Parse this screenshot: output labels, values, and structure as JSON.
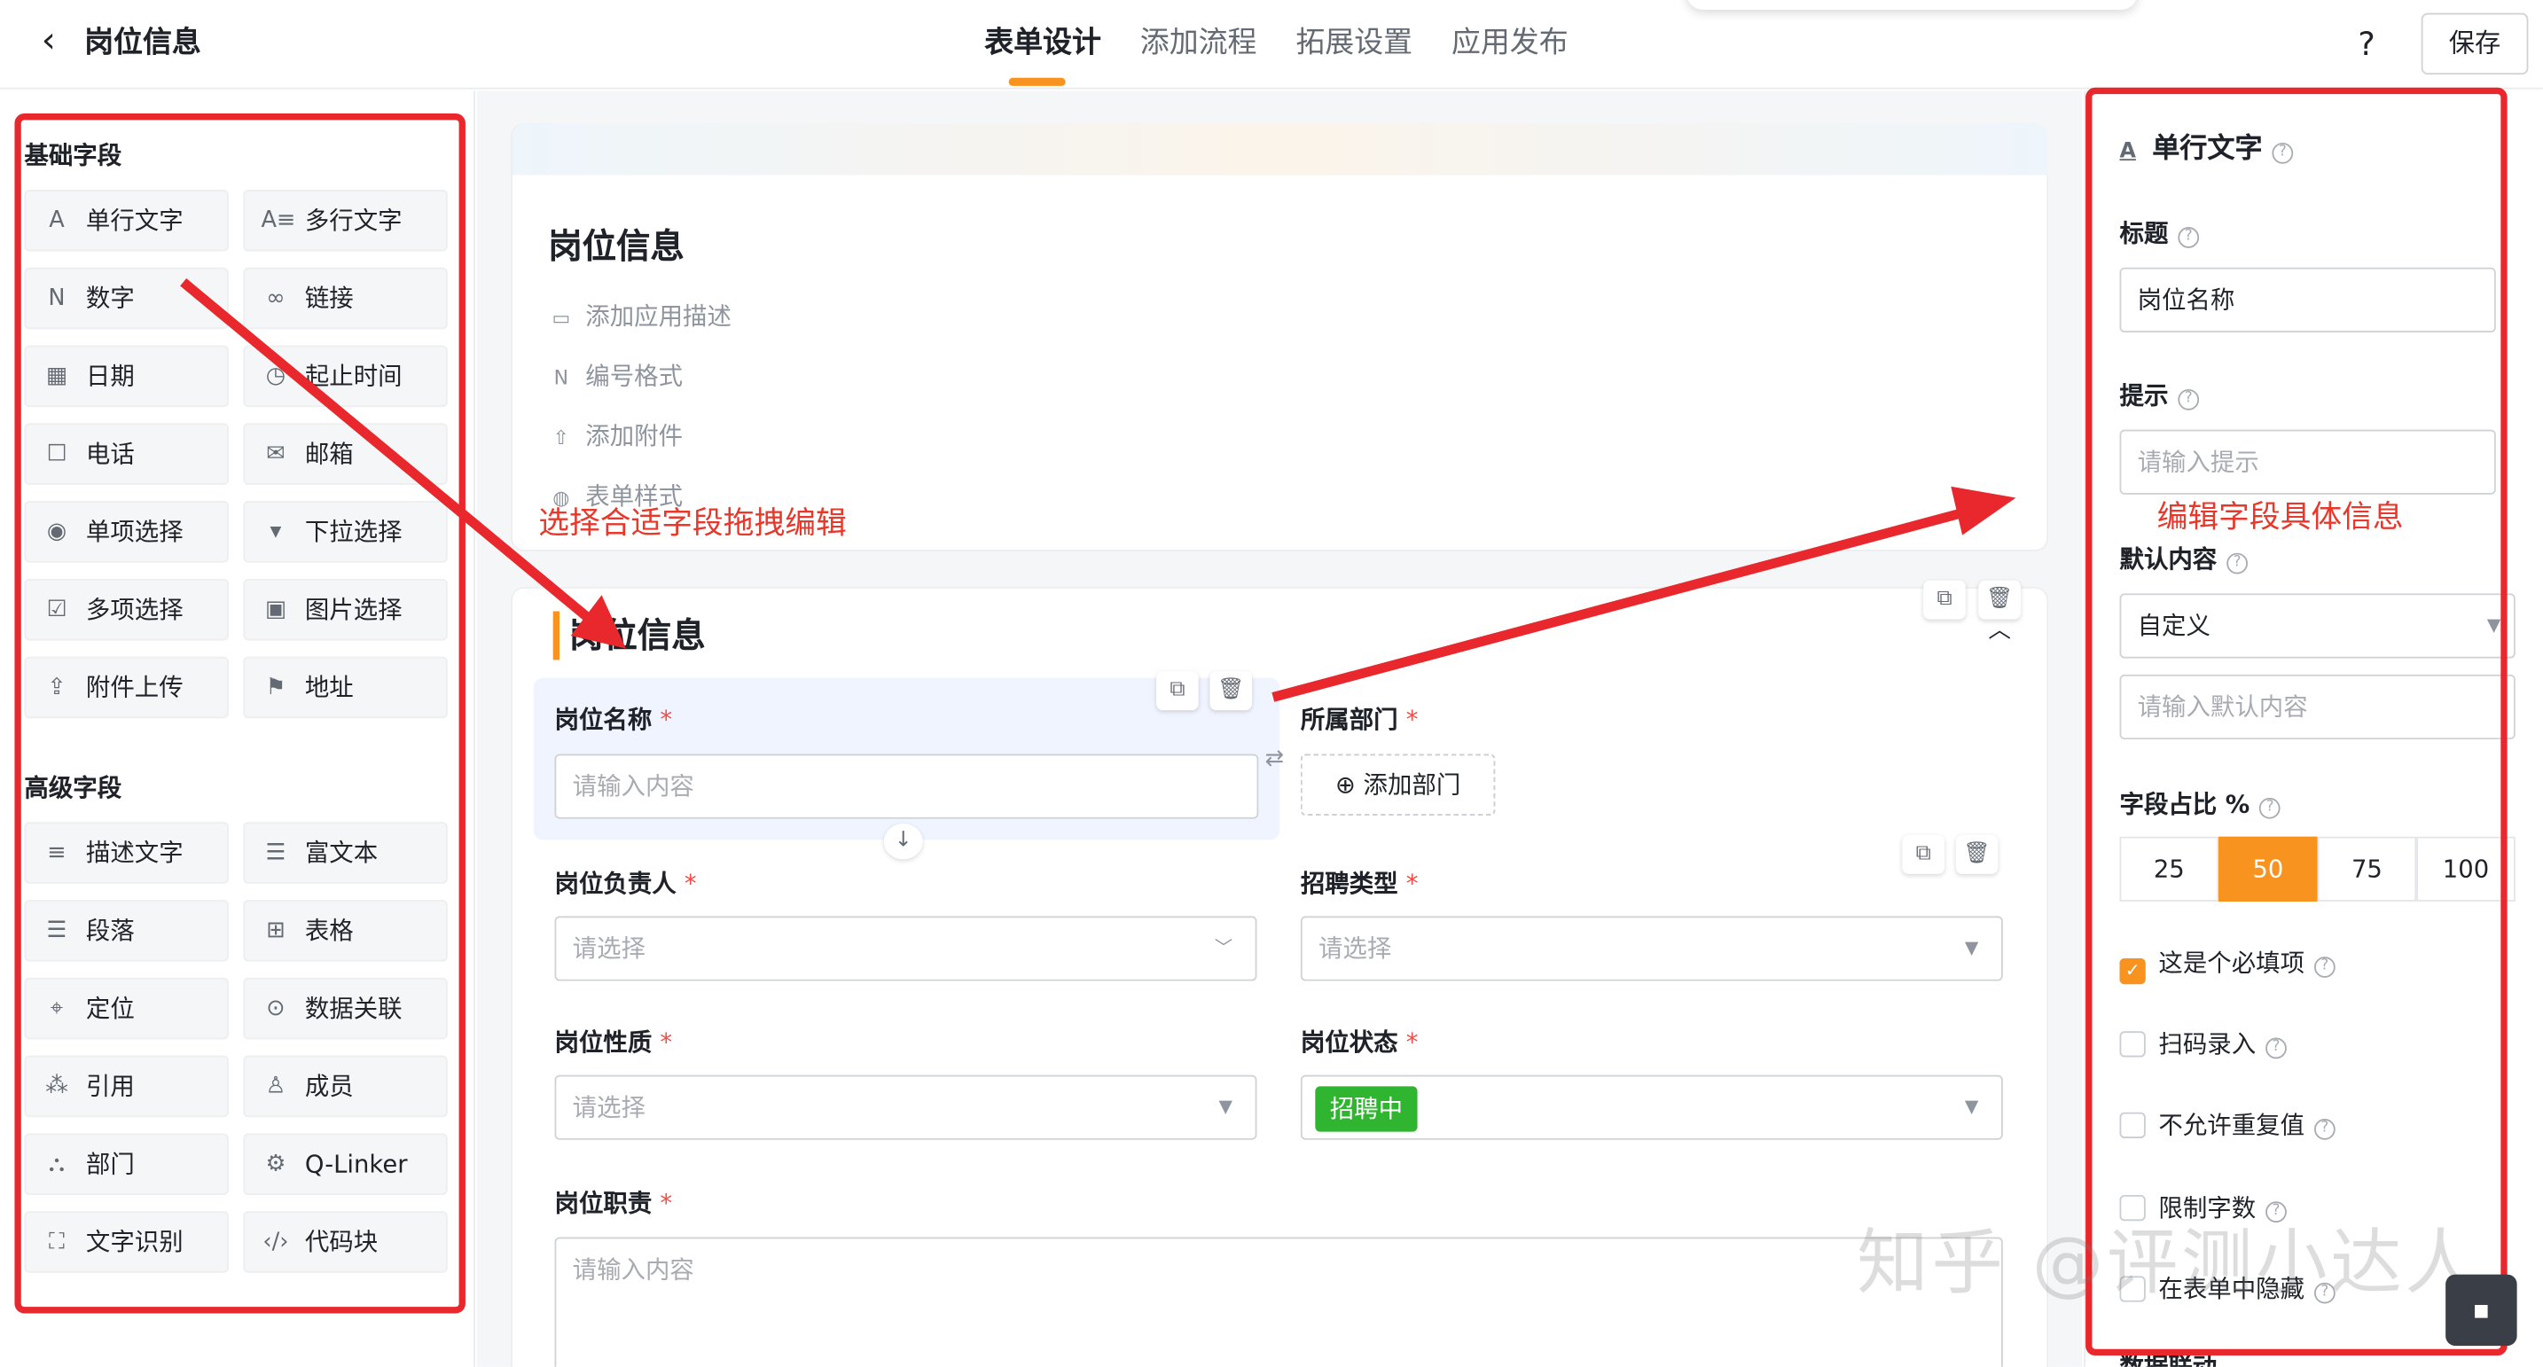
{
  "header": {
    "back_icon": "chevron-left-icon",
    "title": "岗位信息",
    "tabs": [
      "表单设计",
      "添加流程",
      "拓展设置",
      "应用发布"
    ],
    "active_tab": "表单设计",
    "help": "?",
    "save_label": "保存"
  },
  "left_panel": {
    "basic_title": "基础字段",
    "basic_fields": [
      {
        "label": "单行文字",
        "icon": "text-icon",
        "glyph": "A"
      },
      {
        "label": "多行文字",
        "icon": "multiline-text-icon",
        "glyph": "A≡"
      },
      {
        "label": "数字",
        "icon": "number-icon",
        "glyph": "N"
      },
      {
        "label": "链接",
        "icon": "link-icon",
        "glyph": "∞"
      },
      {
        "label": "日期",
        "icon": "calendar-icon",
        "glyph": "▦"
      },
      {
        "label": "起止时间",
        "icon": "date-range-icon",
        "glyph": "◷"
      },
      {
        "label": "电话",
        "icon": "phone-icon",
        "glyph": "☐"
      },
      {
        "label": "邮箱",
        "icon": "mail-icon",
        "glyph": "✉"
      },
      {
        "label": "单项选择",
        "icon": "radio-icon",
        "glyph": "◉"
      },
      {
        "label": "下拉选择",
        "icon": "dropdown-icon",
        "glyph": "▾"
      },
      {
        "label": "多项选择",
        "icon": "checkbox-icon",
        "glyph": "☑"
      },
      {
        "label": "图片选择",
        "icon": "image-icon",
        "glyph": "▣"
      },
      {
        "label": "附件上传",
        "icon": "upload-icon",
        "glyph": "⇪"
      },
      {
        "label": "地址",
        "icon": "address-icon",
        "glyph": "⚑"
      }
    ],
    "advanced_title": "高级字段",
    "advanced_fields": [
      {
        "label": "描述文字",
        "icon": "description-icon",
        "glyph": "≡"
      },
      {
        "label": "富文本",
        "icon": "rich-text-icon",
        "glyph": "☰"
      },
      {
        "label": "段落",
        "icon": "paragraph-icon",
        "glyph": "☰"
      },
      {
        "label": "表格",
        "icon": "table-icon",
        "glyph": "⊞"
      },
      {
        "label": "定位",
        "icon": "location-icon",
        "glyph": "⌖"
      },
      {
        "label": "数据关联",
        "icon": "data-link-icon",
        "glyph": "⊙"
      },
      {
        "label": "引用",
        "icon": "reference-icon",
        "glyph": "⁂"
      },
      {
        "label": "成员",
        "icon": "member-icon",
        "glyph": "♙"
      },
      {
        "label": "部门",
        "icon": "department-icon",
        "glyph": "⛬"
      },
      {
        "label": "Q-Linker",
        "icon": "q-linker-icon",
        "glyph": "⚙"
      },
      {
        "label": "文字识别",
        "icon": "ocr-icon",
        "glyph": "⛶"
      },
      {
        "label": "代码块",
        "icon": "code-icon",
        "glyph": "‹/›"
      }
    ]
  },
  "canvas": {
    "form_title": "岗位信息",
    "meta_items": [
      {
        "label": "添加应用描述",
        "icon": "comment-icon",
        "glyph": "▭"
      },
      {
        "label": "编号格式",
        "icon": "number-format-icon",
        "glyph": "N"
      },
      {
        "label": "添加附件",
        "icon": "upload-icon",
        "glyph": "⇧"
      },
      {
        "label": "表单样式",
        "icon": "palette-icon",
        "glyph": "◍"
      }
    ],
    "group_title": "岗位信息",
    "fields": {
      "position_name": {
        "label": "岗位名称",
        "placeholder": "请输入内容"
      },
      "department": {
        "label": "所属部门",
        "button": "添加部门"
      },
      "owner": {
        "label": "岗位负责人",
        "placeholder": "请选择"
      },
      "recruit_type": {
        "label": "招聘类型",
        "placeholder": "请选择"
      },
      "nature": {
        "label": "岗位性质",
        "placeholder": "请选择"
      },
      "status": {
        "label": "岗位状态",
        "value": "招聘中"
      },
      "duties": {
        "label": "岗位职责",
        "placeholder": "请输入内容"
      }
    },
    "required_mark": "*"
  },
  "annotations": {
    "left_note": "选择合适字段拖拽编辑",
    "right_note": "编辑字段具体信息"
  },
  "right_panel": {
    "field_type": "单行文字",
    "title_label": "标题",
    "title_value": "岗位名称",
    "hint_label": "提示",
    "hint_placeholder": "请输入提示",
    "default_label": "默认内容",
    "default_mode": "自定义",
    "default_placeholder": "请输入默认内容",
    "ratio_label": "字段占比 %",
    "ratio_options": [
      "25",
      "50",
      "75",
      "100"
    ],
    "ratio_selected": "50",
    "checks": [
      {
        "label": "这是个必填项",
        "checked": true
      },
      {
        "label": "扫码录入",
        "checked": false
      },
      {
        "label": "不允许重复值",
        "checked": false
      },
      {
        "label": "限制字数",
        "checked": false
      },
      {
        "label": "在表单中隐藏",
        "checked": false
      }
    ],
    "cut_off_label": "数据联动"
  },
  "watermark": "知乎 @评测小达人",
  "colors": {
    "accent": "#f7931e",
    "annotation_red": "#e8282c",
    "status_green": "#2fb52f"
  }
}
